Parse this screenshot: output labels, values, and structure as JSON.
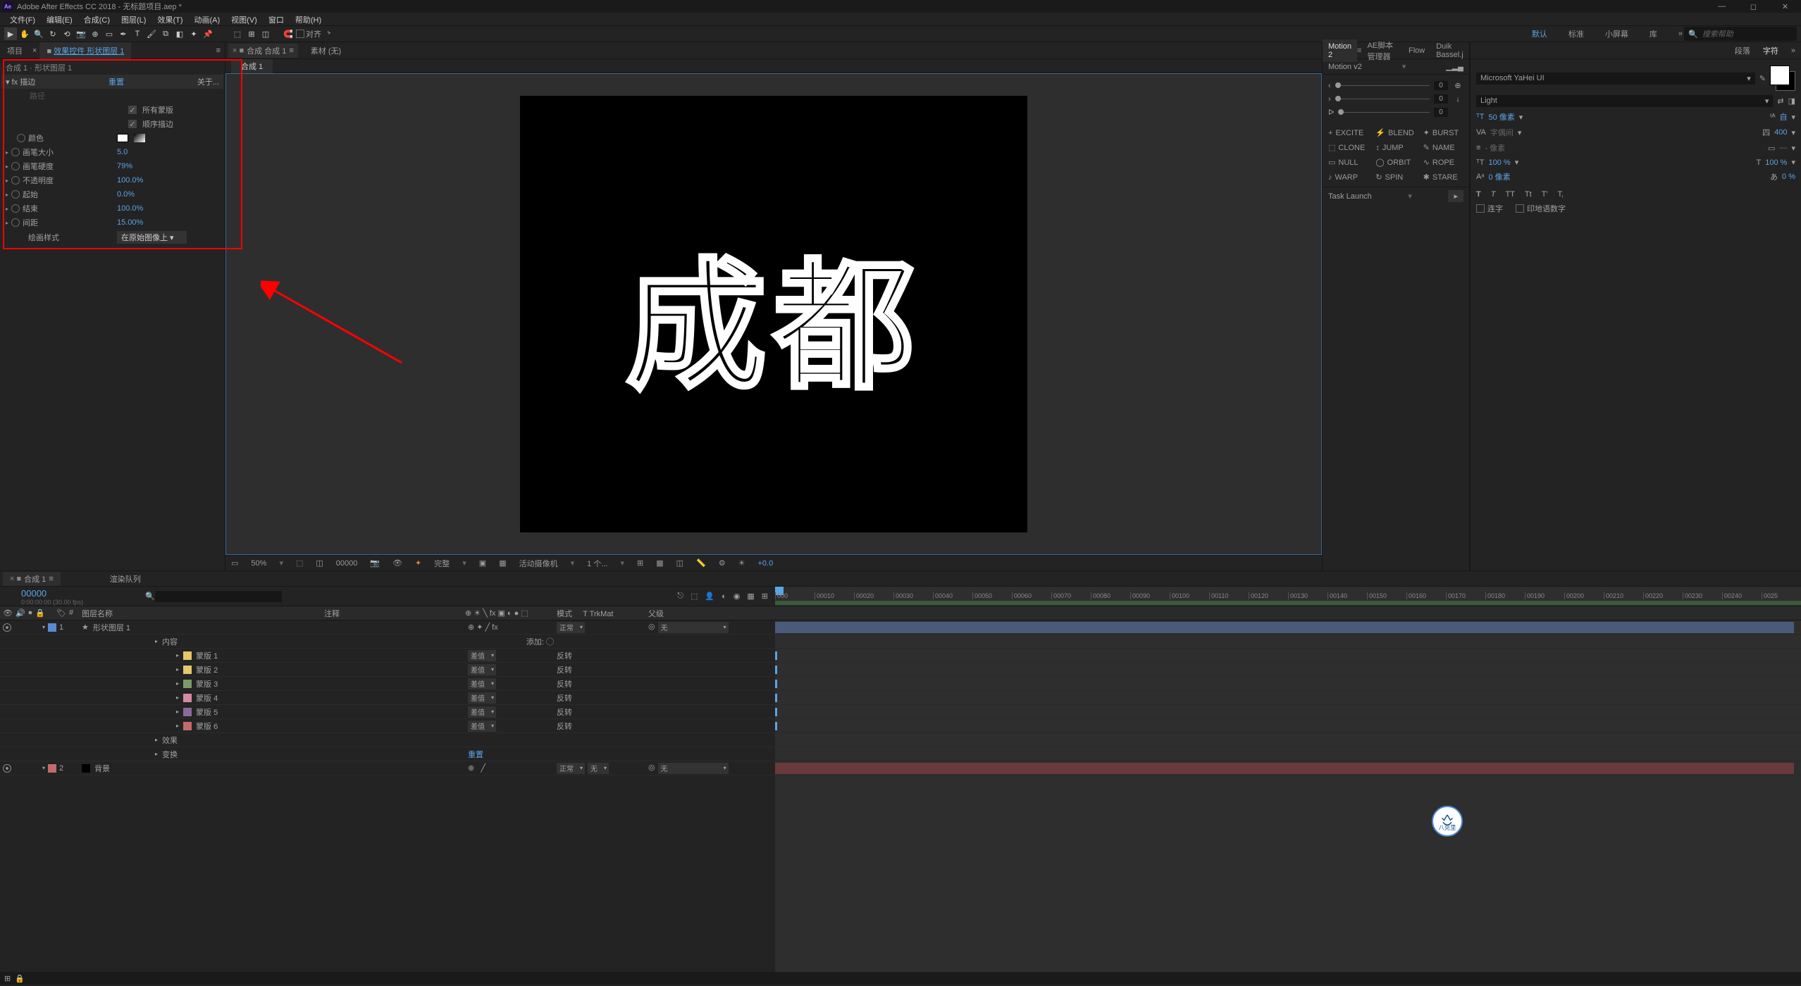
{
  "window": {
    "title": "Adobe After Effects CC 2018 - 无标题项目.aep *",
    "logo": "Ae"
  },
  "menu": [
    "文件(F)",
    "编辑(E)",
    "合成(C)",
    "图层(L)",
    "效果(T)",
    "动画(A)",
    "视图(V)",
    "窗口",
    "帮助(H)"
  ],
  "toolbar": {
    "snapping": "对齐",
    "workspaces": [
      "默认",
      "标准",
      "小屏幕",
      "库"
    ],
    "search_placeholder": "搜索帮助"
  },
  "left_panel": {
    "tabs": [
      "项目",
      "效果控件 形状图层 1"
    ],
    "breadcrumb": "合成 1 · 形状图层 1",
    "effect_name": "描边",
    "reset": "重置",
    "about": "关于...",
    "checks": [
      {
        "label": "所有蒙版",
        "checked": true
      },
      {
        "label": "顺序描边",
        "checked": true
      }
    ],
    "props": [
      {
        "icon": "stopwatch",
        "label": "颜色",
        "type": "color"
      },
      {
        "tri": true,
        "icon": "stopwatch",
        "label": "画笔大小",
        "value": "5.0"
      },
      {
        "tri": true,
        "icon": "stopwatch",
        "label": "画笔硬度",
        "value": "79%"
      },
      {
        "tri": true,
        "icon": "stopwatch",
        "label": "不透明度",
        "value": "100.0%"
      },
      {
        "tri": true,
        "icon": "stopwatch",
        "label": "起始",
        "value": "0.0%"
      },
      {
        "tri": true,
        "icon": "stopwatch",
        "label": "结束",
        "value": "100.0%"
      },
      {
        "tri": true,
        "icon": "stopwatch",
        "label": "间距",
        "value": "15.00%"
      },
      {
        "icon": "",
        "label": "绘画样式",
        "type": "dropdown",
        "value": "在原始图像上"
      }
    ]
  },
  "viewer": {
    "tabs": [
      {
        "icon": "comp",
        "label": "合成 合成 1",
        "active": true
      },
      {
        "label": "素材 (无)"
      }
    ],
    "comp_tab": "合成 1",
    "canvas_text": "成都",
    "bottom": {
      "zoom": "50%",
      "time": "00000",
      "quality": "完整",
      "camera": "活动摄像机",
      "views": "1 个...",
      "exposure": "+0.0"
    }
  },
  "script_panel": {
    "tabs": [
      "Motion 2",
      "AE脚本管理器",
      "Flow",
      "Duik Bassel.j"
    ],
    "title": "Motion v2",
    "sliders": [
      {
        "value": "0"
      },
      {
        "value": "0"
      },
      {
        "value": "0"
      }
    ],
    "tools": [
      {
        "icon": "+",
        "label": "EXCITE"
      },
      {
        "icon": "⚡",
        "label": "BLEND"
      },
      {
        "icon": "✦",
        "label": "BURST"
      },
      {
        "icon": "⬚",
        "label": "CLONE"
      },
      {
        "icon": "↕",
        "label": "JUMP"
      },
      {
        "icon": "✎",
        "label": "NAME"
      },
      {
        "icon": "▭",
        "label": "NULL"
      },
      {
        "icon": "◯",
        "label": "ORBIT"
      },
      {
        "icon": "∿",
        "label": "ROPE"
      },
      {
        "icon": "♪",
        "label": "WARP"
      },
      {
        "icon": "↻",
        "label": "SPIN"
      },
      {
        "icon": "✱",
        "label": "STARE"
      }
    ],
    "task_launch": "Task Launch"
  },
  "char_panel": {
    "tabs": [
      "段落",
      "字符"
    ],
    "font": "Microsoft YaHei UI",
    "weight": "Light",
    "size": "50 像素",
    "leading_label": "自",
    "kerning_label": "字偶间",
    "tracking": "400",
    "stroke_label": "- 像素",
    "vscale": "100 %",
    "hscale": "100 %",
    "baseline": "0 像素",
    "tsume": "0 %",
    "style_btns": [
      "T",
      "T",
      "TT",
      "Tt",
      "T'",
      "T,"
    ],
    "ligatures": "连字",
    "hindi": "印地语数字"
  },
  "timeline": {
    "tabs": [
      "合成 1",
      "渲染队列"
    ],
    "timecode": "00000",
    "timecode_sub": "0:00:00:00 (30.00 fps)",
    "columns": {
      "name": "图层名称",
      "comment": "注释",
      "mode": "模式",
      "trkmat": "T TrkMat",
      "parent": "父级"
    },
    "ruler": [
      "000",
      "00010",
      "00020",
      "00030",
      "00040",
      "00050",
      "00060",
      "00070",
      "00080",
      "00090",
      "00100",
      "00110",
      "00120",
      "00130",
      "00140",
      "00150",
      "00160",
      "00170",
      "00180",
      "00190",
      "00200",
      "00210",
      "00220",
      "00230",
      "00240",
      "0025"
    ],
    "layers": [
      {
        "num": "1",
        "color": "#5a8ad4",
        "icon": "★",
        "name": "形状图层 1",
        "mode": "正常",
        "parent": "无",
        "bar": "blue"
      },
      {
        "sub": true,
        "name": "内容",
        "add_label": "添加:"
      },
      {
        "sub": true,
        "indent": 2,
        "color": "#e6c76a",
        "name": "蒙版 1",
        "modedd": "差值",
        "inv": "反转"
      },
      {
        "sub": true,
        "indent": 2,
        "color": "#e6c76a",
        "name": "蒙版 2",
        "modedd": "差值",
        "inv": "反转"
      },
      {
        "sub": true,
        "indent": 2,
        "color": "#7a9a6a",
        "name": "蒙版 3",
        "modedd": "差值",
        "inv": "反转"
      },
      {
        "sub": true,
        "indent": 2,
        "color": "#d48aa4",
        "name": "蒙版 4",
        "modedd": "差值",
        "inv": "反转"
      },
      {
        "sub": true,
        "indent": 2,
        "color": "#8a6a9a",
        "name": "蒙版 5",
        "modedd": "差值",
        "inv": "反转"
      },
      {
        "sub": true,
        "indent": 2,
        "color": "#c46a6a",
        "name": "蒙版 6",
        "modedd": "差值",
        "inv": "反转"
      },
      {
        "sub": true,
        "indent": 1,
        "name": "效果"
      },
      {
        "sub": true,
        "indent": 1,
        "name": "变换",
        "reset": "重置"
      },
      {
        "num": "2",
        "color": "#c46a6a",
        "solid": "#000",
        "name": "背景",
        "mode": "正常",
        "trkmat": "无",
        "parent": "无",
        "bar": "red"
      }
    ]
  }
}
